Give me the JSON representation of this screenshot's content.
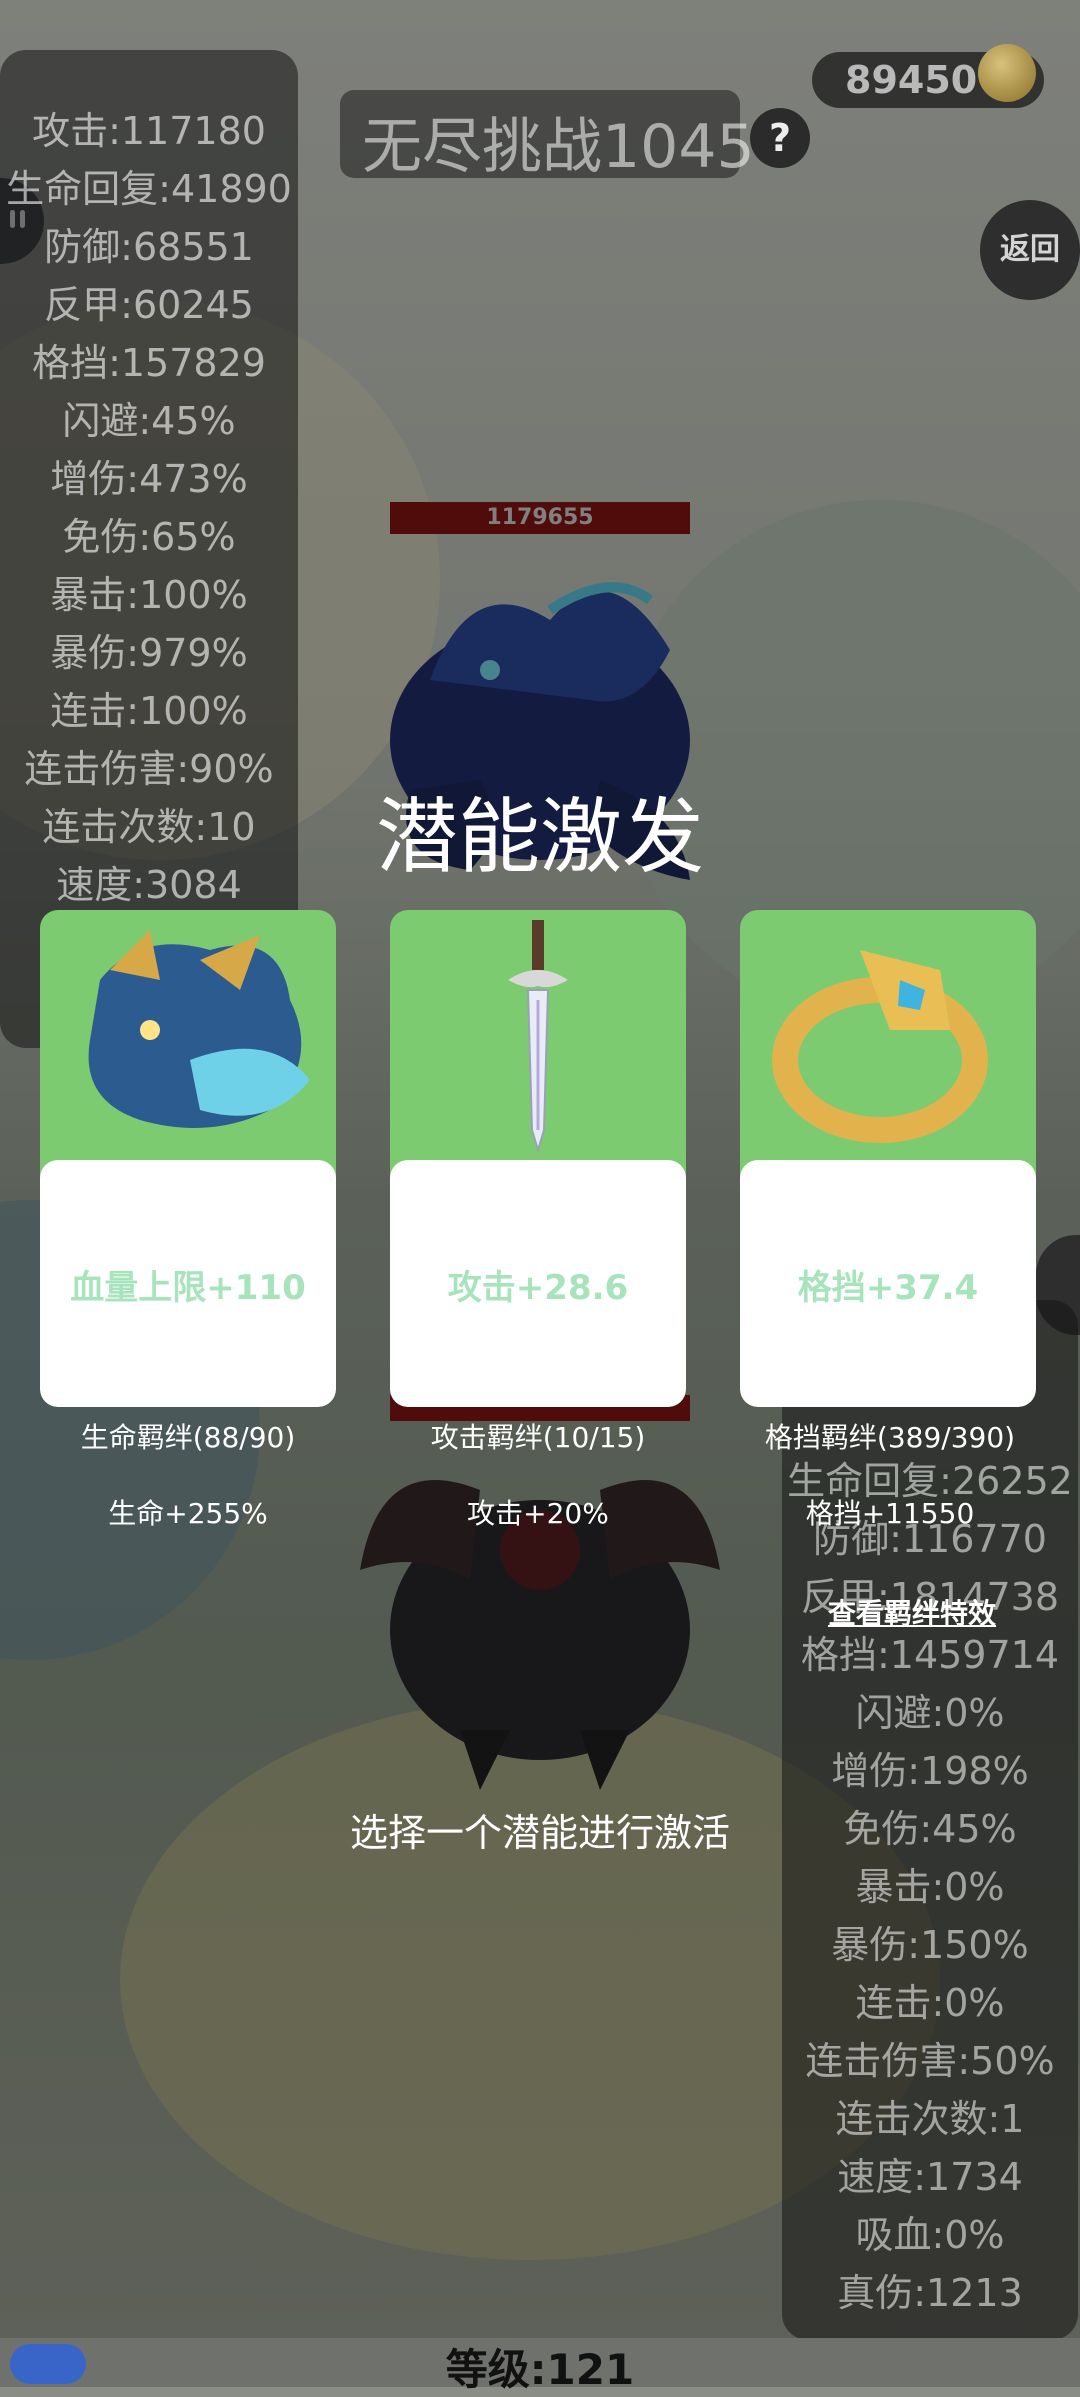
{
  "header": {
    "title": "无尽挑战1045",
    "help_label": "?",
    "coins": "89450",
    "back_label": "返回"
  },
  "player_stats": [
    "攻击:117180",
    "生命回复:41890",
    "防御:68551",
    "反甲:60245",
    "格挡:157829",
    "闪避:45%",
    "增伤:473%",
    "免伤:65%",
    "暴击:100%",
    "暴伤:979%",
    "连击:100%",
    "连击伤害:90%",
    "连击次数:10",
    "速度:3084"
  ],
  "enemy_stats": [
    "生命回复:26252",
    "防御:116770",
    "反甲:1814738",
    "格挡:1459714",
    "闪避:0%",
    "增伤:198%",
    "免伤:45%",
    "暴击:0%",
    "暴伤:150%",
    "连击:0%",
    "连击伤害:50%",
    "连击次数:1",
    "速度:1734",
    "吸血:0%",
    "真伤:1213"
  ],
  "enemy_top": {
    "hp": "1179655"
  },
  "overlay": {
    "title": "潜能激发",
    "hint": "选择一个潜能进行激活",
    "view_bond_effects": "查看羁绊特效",
    "cards": [
      {
        "icon": "dragon-beast-icon",
        "effect": "血量上限+110",
        "bond": "生命羁绊(88/90)",
        "bonus": "生命+255%"
      },
      {
        "icon": "sword-icon",
        "effect": "攻击+28.6",
        "bond": "攻击羁绊(10/15)",
        "bonus": "攻击+20%"
      },
      {
        "icon": "ring-icon",
        "effect": "格挡+37.4",
        "bond": "格挡羁绊(389/390)",
        "bonus": "格挡+11550"
      }
    ]
  },
  "footer": {
    "level": "等级:121"
  },
  "colors": {
    "card_top": "#7dcb71",
    "card_text": "#a8e4bb",
    "hp_bar": "#8a1414",
    "exp_bar": "#3a65c8"
  }
}
